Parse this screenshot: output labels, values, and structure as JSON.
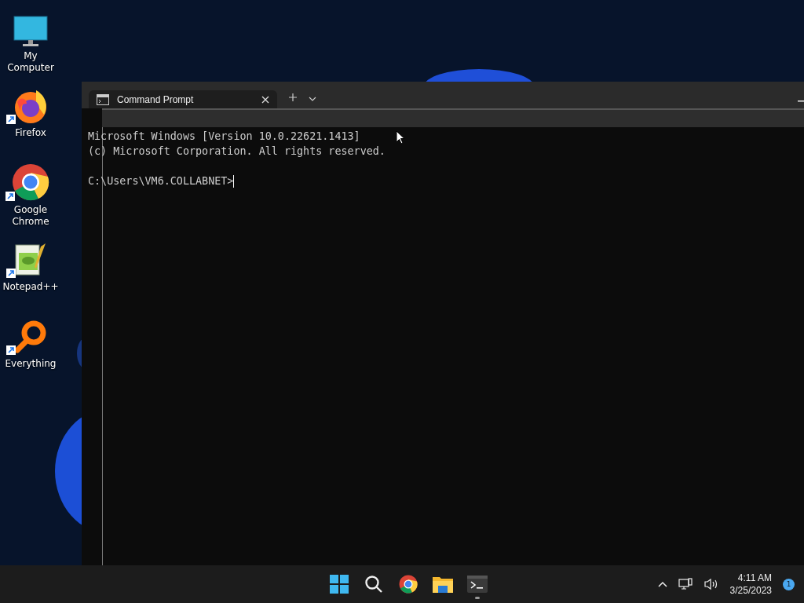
{
  "desktop_icons": [
    {
      "label": "My Computer",
      "kind": "computer",
      "shortcut": false
    },
    {
      "label": "Firefox",
      "kind": "firefox",
      "shortcut": true
    },
    {
      "label": "Google Chrome",
      "kind": "chrome",
      "shortcut": true
    },
    {
      "label": "Notepad++",
      "kind": "notepad",
      "shortcut": true
    },
    {
      "label": "Everything",
      "kind": "everything",
      "shortcut": true
    }
  ],
  "window": {
    "tabs": [
      {
        "title": "Command Prompt",
        "selected": true
      }
    ],
    "terminal": {
      "lines": [
        "Microsoft Windows [Version 10.0.22621.1413]",
        "(c) Microsoft Corporation. All rights reserved."
      ],
      "prompt": "C:\\Users\\VM6.COLLABNET>"
    }
  },
  "taskbar": {
    "apps": [
      {
        "kind": "start",
        "running": false
      },
      {
        "kind": "search",
        "running": false
      },
      {
        "kind": "chrome",
        "running": false
      },
      {
        "kind": "folder",
        "running": false
      },
      {
        "kind": "terminal",
        "running": true
      }
    ],
    "time": "4:11 AM",
    "date": "3/25/2023",
    "notifications": "1"
  }
}
